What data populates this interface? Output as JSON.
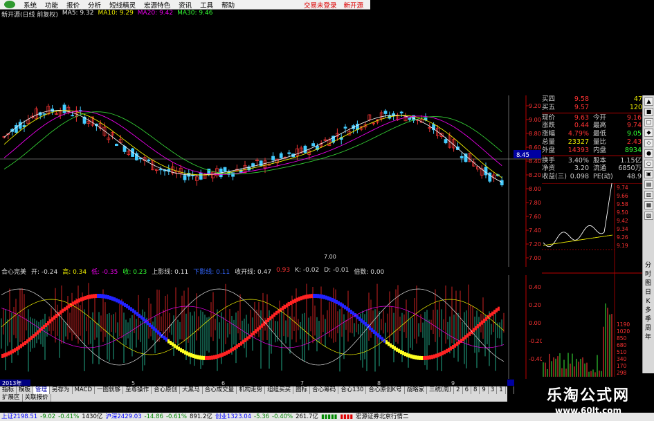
{
  "menubar": {
    "items": [
      "系统",
      "功能",
      "报价",
      "分析",
      "短线精灵",
      "宏源特色",
      "资讯",
      "工具",
      "帮助"
    ],
    "right": [
      "交易未登录",
      "新开源"
    ]
  },
  "ma_line": {
    "stock": "新开源(日线 前复权)",
    "ma5": "MA5: 9.32",
    "ma10": "MA10: 9.29",
    "ma20": "MA20: 9.42",
    "ma30": "MA30: 9.46"
  },
  "price_axis": [
    "9.20",
    "9.00",
    "8.80",
    "8.60",
    "8.40",
    "8.20",
    "8.00",
    "7.80",
    "7.60",
    "7.40",
    "7.20",
    "7.00"
  ],
  "crosshair_label": "8.45",
  "low_marker": "7.00",
  "indicator_line": {
    "name": "合心完美",
    "open": "开: -0.24",
    "high": "高: 0.34",
    "low": "低: -0.35",
    "close": "收: 0.23",
    "upper": "上影线: 0.11",
    "blue": "下影线: 0.11",
    "close_line": "收开线: 0.47",
    "v1": "0.93",
    "k": "K: -0.02",
    "d": "D: -0.01",
    "mult": "倍数: 0.00"
  },
  "indicator_axis": [
    "0.40",
    "0.20",
    "0.00",
    "-0.20",
    "-0.40"
  ],
  "time_axis": [
    "2013年",
    "5",
    "6",
    "7",
    "8",
    "9"
  ],
  "quote": {
    "rows": [
      {
        "l": "买四",
        "v": "9.58",
        "v_color": "#f33",
        "r": "47",
        "r_color": "#ee0"
      },
      {
        "l": "买五",
        "v": "9.57",
        "v_color": "#f33",
        "r": "120",
        "r_color": "#ee0"
      },
      {
        "l": "现价",
        "v": "9.63",
        "v_color": "#f33",
        "l2": "今开",
        "v2": "9.16",
        "v2_color": "#f33"
      },
      {
        "l": "涨跌",
        "v": "0.44",
        "v_color": "#f33",
        "l2": "最高",
        "v2": "9.74",
        "v2_color": "#f33"
      },
      {
        "l": "涨幅",
        "v": "4.79%",
        "v_color": "#f33",
        "l2": "最低",
        "v2": "9.05",
        "v2_color": "#3f3"
      },
      {
        "l": "总量",
        "v": "23327",
        "v_color": "#ee0",
        "l2": "量比",
        "v2": "2.43",
        "v2_color": "#f33"
      },
      {
        "l": "外盘",
        "v": "14393",
        "v_color": "#f33",
        "l2": "内盘",
        "v2": "8934",
        "v2_color": "#3f3"
      },
      {
        "l": "换手",
        "v": "3.40%",
        "v_color": "#ccc",
        "l2": "股本",
        "v2": "1.15亿",
        "v2_color": "#ccc"
      },
      {
        "l": "净资",
        "v": "3.20",
        "v_color": "#ccc",
        "l2": "流通",
        "v2": "6850万",
        "v2_color": "#ccc"
      },
      {
        "l": "收益(三)",
        "v": "0.098",
        "v_color": "#ccc",
        "l2": "PE(动)",
        "v2": "48.9",
        "v2_color": "#ccc"
      }
    ]
  },
  "minute_axis": [
    "9.74",
    "9.66",
    "9.58",
    "9.50",
    "9.42",
    "9.34",
    "9.26",
    "9.19"
  ],
  "volume_axis": [
    "1190",
    "1020",
    "850",
    "680",
    "510",
    "340",
    "170",
    "298"
  ],
  "sidebar_cjk": [
    "分",
    "时",
    "图",
    "日",
    "K",
    "多",
    "季",
    "周",
    "年"
  ],
  "tabs": [
    "指标",
    "模板",
    "管理",
    "另存为",
    "MACD",
    "一图就够",
    "至尊操作",
    "合心原创",
    "大黑马",
    "合心成交量",
    "机构走势",
    "组组买买",
    "图标",
    "合心筹码",
    "合心130",
    "合心原创K号",
    "战略家",
    "三统(周)",
    "2",
    "6",
    "8",
    "9",
    "3",
    "1",
    "4",
    "5"
  ],
  "tabs2": [
    "扩展区",
    "关联报价"
  ],
  "status": {
    "sh": "上证2198.51",
    "sh_chg": "-9.02",
    "sh_pct": "-0.41%",
    "sh_amt": "1430亿",
    "sz": "沪深2429.03",
    "sz_chg": "-14.86",
    "sz_pct": "-0.61%",
    "sz_amt": "891.2亿",
    "cy": "创业1323.04",
    "cy_chg": "-5.36",
    "cy_pct": "-0.40%",
    "cy_amt": "261.7亿",
    "broker": "宏源证券北京行情二"
  },
  "watermark": {
    "title": "乐淘公式网",
    "url": "www.60lt.com"
  }
}
